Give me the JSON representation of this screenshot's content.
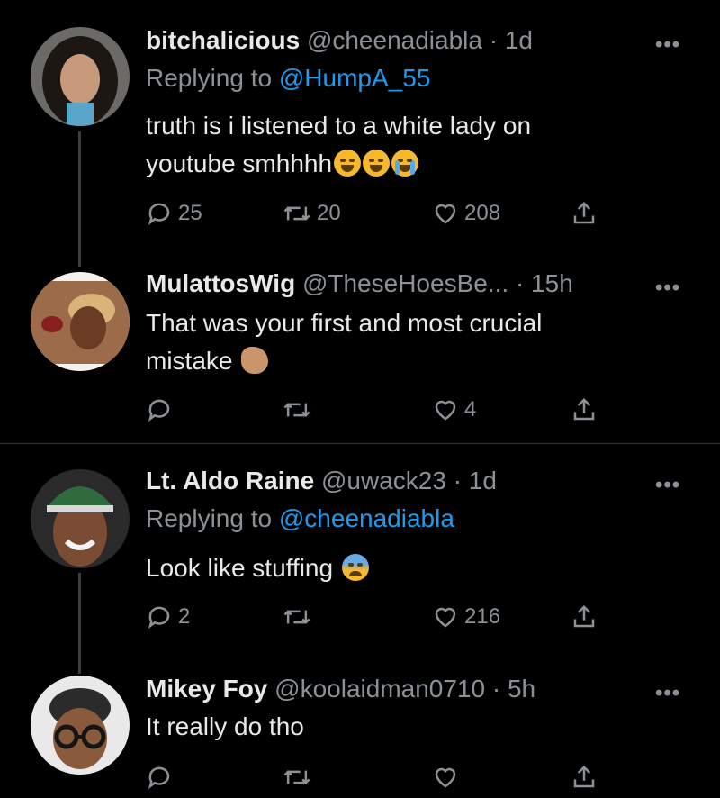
{
  "tweets": [
    {
      "name": "bitchalicious",
      "handle": "@cheenadiabla",
      "separator": "·",
      "time": "1d",
      "replying_label": "Replying to",
      "replying_to": "@HumpA_55",
      "text_lines": [
        "truth is i listened to a white lady on",
        "youtube smhhhh"
      ],
      "emoji_names": [
        "rolling-laughing-emoji",
        "rolling-laughing-emoji",
        "loudly-crying-emoji"
      ],
      "replies": "25",
      "retweets": "20",
      "likes": "208",
      "more": "•••"
    },
    {
      "name": "MulattosWig",
      "handle": "@TheseHoesBe...",
      "separator": "·",
      "time": "15h",
      "text_lines": [
        "That was your first and most crucial",
        "mistake"
      ],
      "emoji_names": [
        "clapping-hands-emoji"
      ],
      "replies": "",
      "retweets": "",
      "likes": "4",
      "more": "•••"
    },
    {
      "name": "Lt. Aldo Raine",
      "handle": "@uwack23",
      "separator": "·",
      "time": "1d",
      "replying_label": "Replying to",
      "replying_to": "@cheenadiabla",
      "text_lines": [
        "Look like stuffing"
      ],
      "emoji_names": [
        "anxious-face-emoji"
      ],
      "replies": "2",
      "retweets": "",
      "likes": "216",
      "more": "•••"
    },
    {
      "name": "Mikey Foy",
      "handle": "@koolaidman0710",
      "separator": "·",
      "time": "5h",
      "text_lines": [
        "It really do tho"
      ],
      "replies": "",
      "retweets": "",
      "likes": "",
      "more": "•••"
    }
  ],
  "colors": {
    "background": "#000000",
    "text": "#e7e9ea",
    "secondary": "#8b9196",
    "mention": "#1d9bf0",
    "divider": "#2f3336"
  },
  "icons": [
    "reply-icon",
    "retweet-icon",
    "like-icon",
    "share-icon",
    "more-icon"
  ]
}
